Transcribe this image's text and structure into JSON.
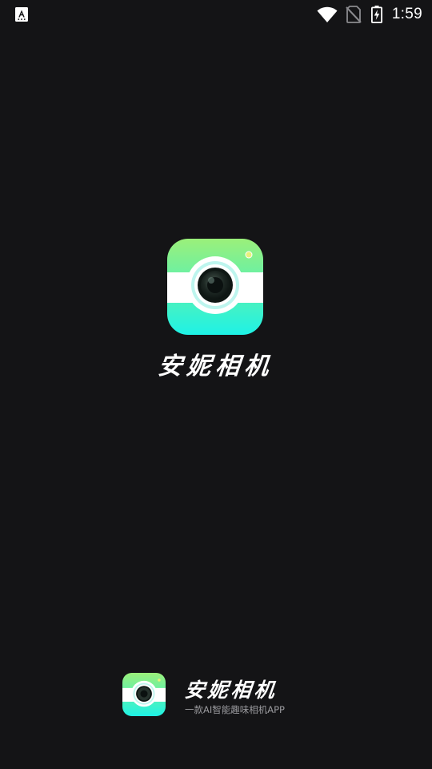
{
  "status_bar": {
    "time": "1:59",
    "icons": [
      "app-notification-icon",
      "wifi-icon",
      "no-sim-icon",
      "battery-charging-icon"
    ]
  },
  "splash": {
    "app_name": "安妮相机"
  },
  "footer": {
    "app_name": "安妮相机",
    "tagline": "一款AI智能趣味相机APP"
  },
  "colors": {
    "background": "#141416",
    "logo_gradient_top": "#9bf07a",
    "logo_gradient_bottom": "#1ef2e6",
    "tagline": "#9a9a9e"
  }
}
